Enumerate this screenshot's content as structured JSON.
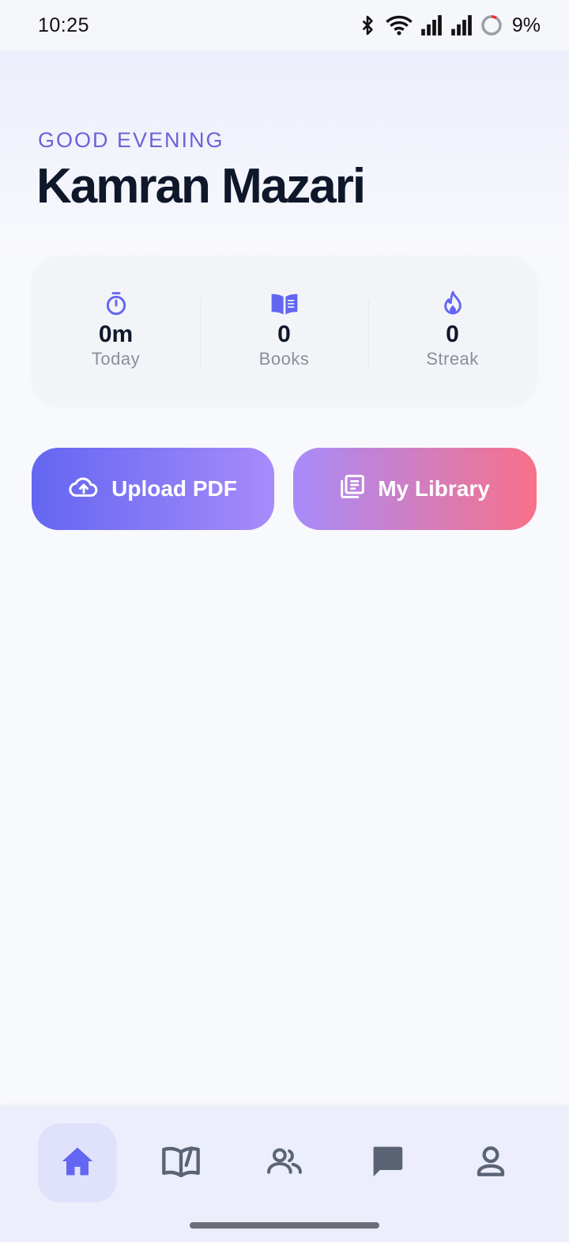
{
  "status_bar": {
    "time": "10:25",
    "battery": "9%",
    "icons": [
      "bluetooth-icon",
      "wifi-icon",
      "signal-icon",
      "signal-icon",
      "battery-ring-icon"
    ]
  },
  "header": {
    "greeting": "GOOD EVENING",
    "name": "Kamran Mazari"
  },
  "stats": [
    {
      "icon": "stopwatch-icon",
      "value": "0m",
      "label": "Today"
    },
    {
      "icon": "book-icon",
      "value": "0",
      "label": "Books"
    },
    {
      "icon": "flame-icon",
      "value": "0",
      "label": "Streak"
    }
  ],
  "actions": {
    "upload_label": "Upload PDF",
    "library_label": "My Library"
  },
  "nav": {
    "items": [
      {
        "icon": "home-icon",
        "active": true
      },
      {
        "icon": "open-book-icon",
        "active": false
      },
      {
        "icon": "people-icon",
        "active": false
      },
      {
        "icon": "chat-icon",
        "active": false
      },
      {
        "icon": "profile-icon",
        "active": false
      }
    ]
  },
  "colors": {
    "accent": "#6366f1",
    "accent_text": "#6b63d6",
    "nav_icon": "#5b6475",
    "gradient_pink": "#f87189"
  }
}
